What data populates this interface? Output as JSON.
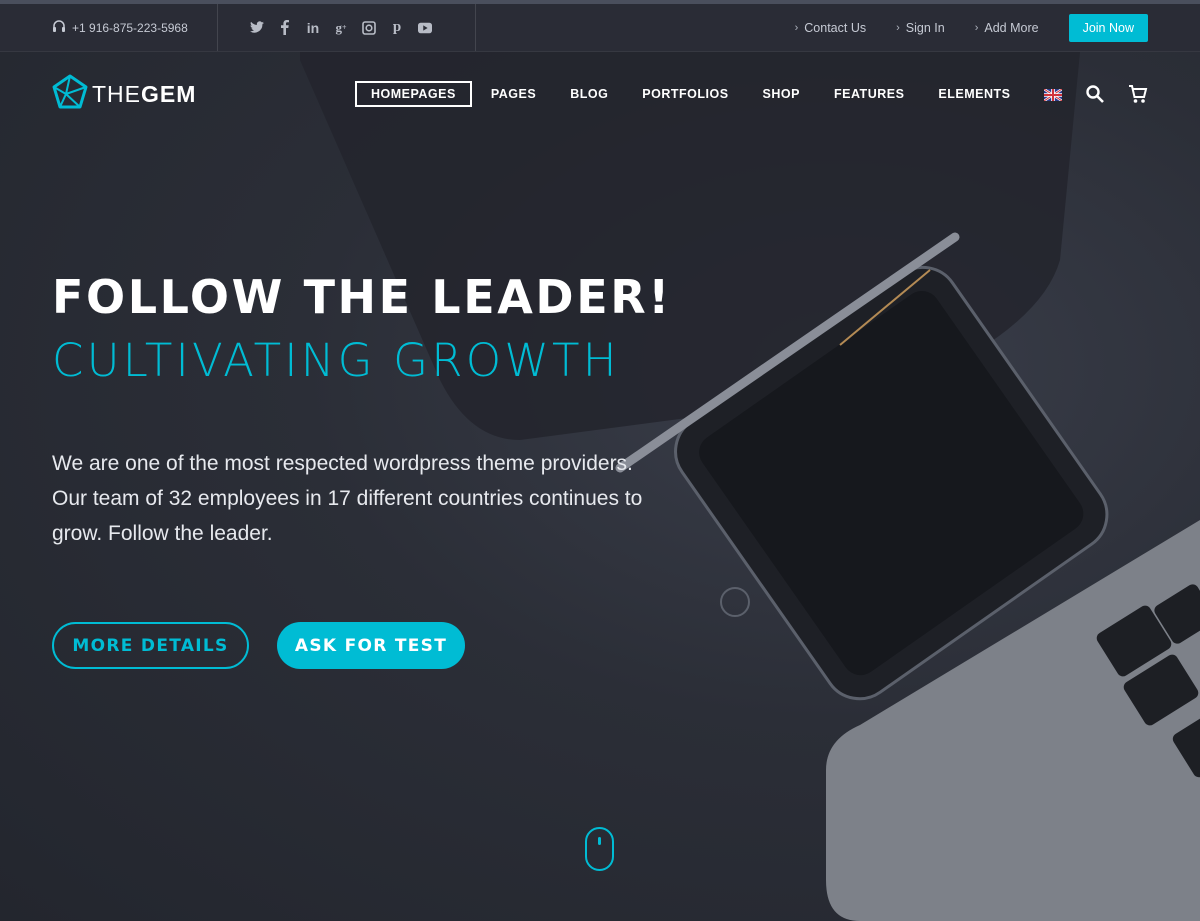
{
  "topbar": {
    "phone": "+1 916-875-223-5968",
    "social": [
      "twitter-icon",
      "facebook-icon",
      "linkedin-icon",
      "googleplus-icon",
      "instagram-icon",
      "pinterest-icon",
      "youtube-icon"
    ],
    "links": [
      "Contact Us",
      "Sign In",
      "Add More"
    ],
    "join_label": "Join Now"
  },
  "logo": {
    "light": "THE",
    "bold": "GEM"
  },
  "nav": {
    "items": [
      "HOMEPAGES",
      "PAGES",
      "BLOG",
      "PORTFOLIOS",
      "SHOP",
      "FEATURES",
      "ELEMENTS"
    ],
    "active": "HOMEPAGES"
  },
  "hero": {
    "title": "FOLLOW THE LEADER!",
    "subtitle": "CULTIVATING GROWTH",
    "lead": "We are one of the most respected wordpress theme providers. Our team of 32 employees in 17 different countries continues to grow. Follow the leader.",
    "button_outline": "MORE DETAILS",
    "button_fill": "ASK FOR TEST"
  },
  "colors": {
    "accent": "#00bcd4",
    "background": "#2a2d36",
    "text": "#ffffff"
  }
}
